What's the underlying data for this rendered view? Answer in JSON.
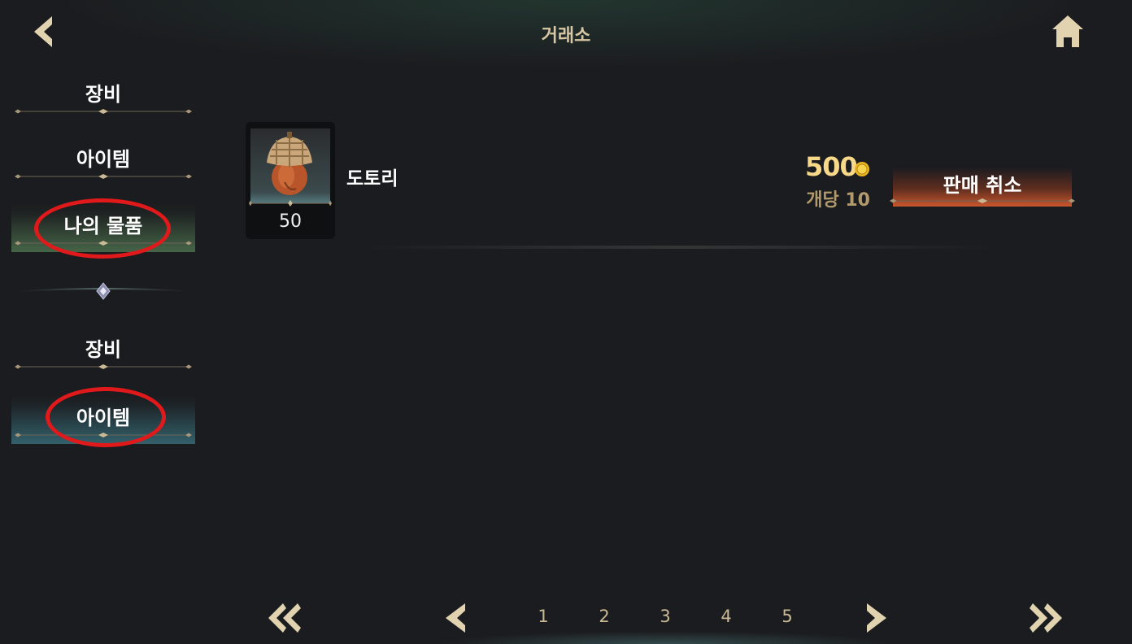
{
  "header": {
    "title": "거래소",
    "back_icon": "chevron-left-icon",
    "home_icon": "home-icon"
  },
  "sidebar": {
    "group1": [
      {
        "label": "장비",
        "active": false
      },
      {
        "label": "아이템",
        "active": false
      },
      {
        "label": "나의 물품",
        "active": true
      }
    ],
    "group2": [
      {
        "label": "장비",
        "active": false
      },
      {
        "label": "아이템",
        "active": true
      }
    ]
  },
  "listing": {
    "item_name": "도토리",
    "quantity": "50",
    "price": "500",
    "per_unit": "개당 10",
    "cancel_label": "판매 취소",
    "item_icon": "acorn-icon",
    "currency_icon": "gold-coin-icon"
  },
  "pagination": {
    "pages": [
      "1",
      "2",
      "3",
      "4",
      "5"
    ],
    "first_icon": "double-chevron-left-icon",
    "prev_icon": "chevron-left-icon",
    "next_icon": "chevron-right-icon",
    "last_icon": "double-chevron-right-icon"
  },
  "colors": {
    "accent_gold": "#d8c7a2",
    "price_gold": "#f8d98a",
    "highlight_ring": "#e0191b",
    "cancel_orange": "#c9572d"
  }
}
